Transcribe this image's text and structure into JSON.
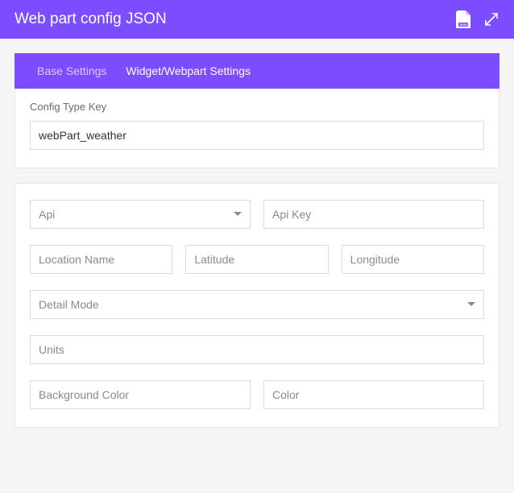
{
  "header": {
    "title": "Web part config JSON"
  },
  "tabs": [
    {
      "label": "Base Settings",
      "active": true
    },
    {
      "label": "Widget/Webpart Settings",
      "active": false
    }
  ],
  "configKey": {
    "label": "Config Type Key",
    "value": "webPart_weather"
  },
  "fields": {
    "api": {
      "placeholder": "Api"
    },
    "apiKey": {
      "placeholder": "Api Key"
    },
    "locationName": {
      "placeholder": "Location Name"
    },
    "latitude": {
      "placeholder": "Latitude"
    },
    "longitude": {
      "placeholder": "Longitude"
    },
    "detailMode": {
      "placeholder": "Detail Mode"
    },
    "units": {
      "placeholder": "Units"
    },
    "backgroundColor": {
      "placeholder": "Background Color"
    },
    "color": {
      "placeholder": "Color"
    }
  }
}
